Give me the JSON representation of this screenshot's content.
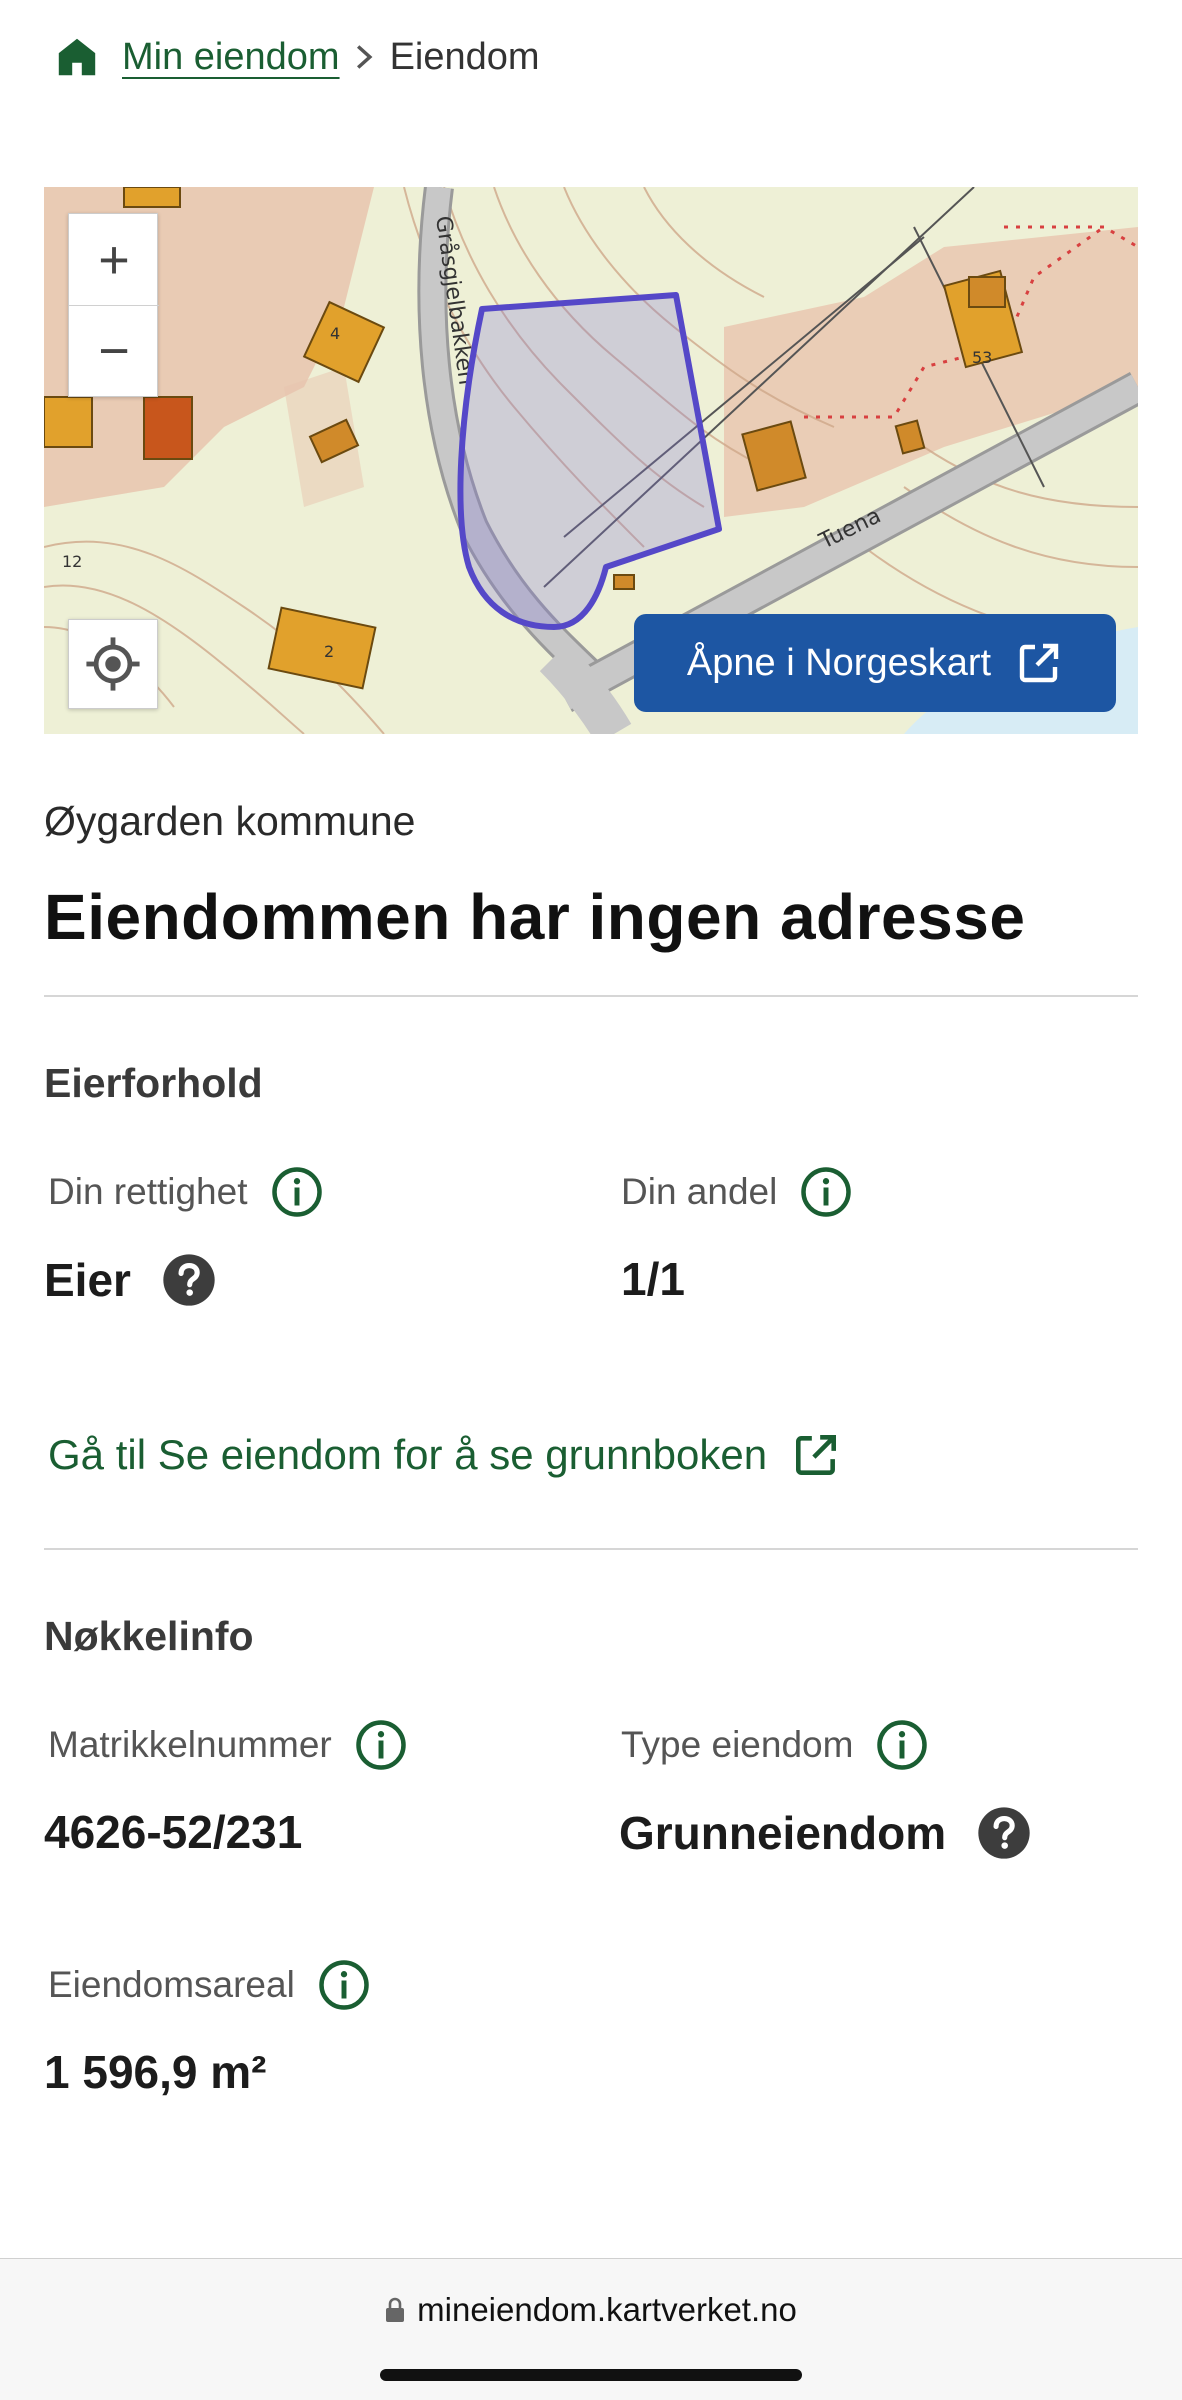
{
  "breadcrumb": {
    "home_icon": "home-icon",
    "link_label": "Min eiendom",
    "separator_icon": "chevron-right-icon",
    "current_label": "Eiendom"
  },
  "map": {
    "zoom_in_label": "+",
    "zoom_out_label": "−",
    "locate_icon": "locate-icon",
    "open_button_label": "Åpne i Norgeskart",
    "open_button_icon": "external-link-icon",
    "road_labels": [
      "Gråsgjelbakken",
      "Tuena"
    ],
    "house_numbers": [
      "4",
      "53",
      "2",
      "12"
    ],
    "parcel_color": "#5548c8",
    "button_color": "#1d56a3"
  },
  "property": {
    "municipality": "Øygarden kommune",
    "title": "Eiendommen har ingen adresse"
  },
  "ownership": {
    "section_title": "Eierforhold",
    "right_label": "Din rettighet",
    "right_value": "Eier",
    "share_label": "Din andel",
    "share_value": "1/1",
    "link_label": "Gå til Se eiendom for å se grunnboken"
  },
  "keyinfo": {
    "section_title": "Nøkkelinfo",
    "cadastre_label": "Matrikkelnummer",
    "cadastre_value": "4626-52/231",
    "type_label": "Type eiendom",
    "type_value": "Grunneiendom",
    "area_label": "Eiendomsareal",
    "area_value": "1 596,9 m²"
  },
  "browser": {
    "url": "mineiendom.kartverket.no",
    "lock_icon": "lock-icon"
  },
  "colors": {
    "accent_green": "#1a5e32",
    "text_dark": "#1c1c1c"
  }
}
